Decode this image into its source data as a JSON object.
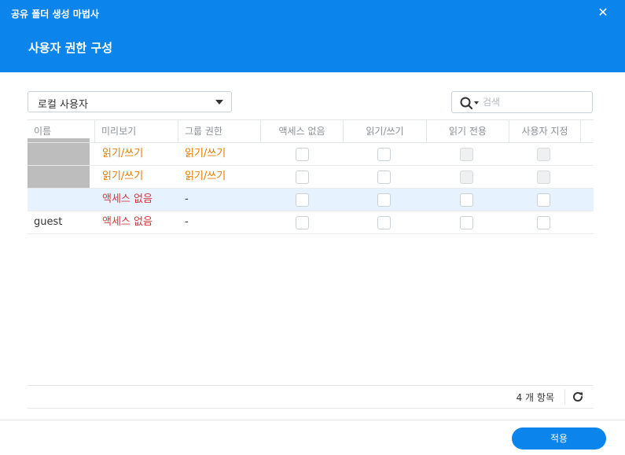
{
  "window": {
    "title": "공유 폴더 생성 마법사",
    "close_icon": "close-icon"
  },
  "page": {
    "title": "사용자 권한 구성"
  },
  "filter": {
    "selected": "로컬 사용자"
  },
  "search": {
    "placeholder": "검색"
  },
  "table": {
    "columns": [
      "이름",
      "미리보기",
      "그룹 권한",
      "액세스 없음",
      "읽기/쓰기",
      "읽기 전용",
      "사용자 지정"
    ],
    "rows": [
      {
        "name": "",
        "preview": "읽기/쓰기",
        "group": "읽기/쓰기",
        "preview_color": "#e87a00",
        "group_color": "#e87a00",
        "selected": false
      },
      {
        "name": "",
        "preview": "읽기/쓰기",
        "group": "읽기/쓰기",
        "preview_color": "#e87a00",
        "group_color": "#e87a00",
        "selected": false
      },
      {
        "name": "",
        "preview": "액세스 없음",
        "group": "-",
        "preview_color": "#d9343c",
        "selected": true
      },
      {
        "name": "guest",
        "preview": "액세스 없음",
        "group": "-",
        "preview_color": "#d9343c",
        "selected": false
      }
    ]
  },
  "footer": {
    "item_count": "4 개 항목"
  },
  "actions": {
    "apply": "적용"
  },
  "colors": {
    "accent": "#0b84ec",
    "readwrite": "#e87a00",
    "noaccess": "#d9343c",
    "selected_row": "#e6f2fd"
  }
}
